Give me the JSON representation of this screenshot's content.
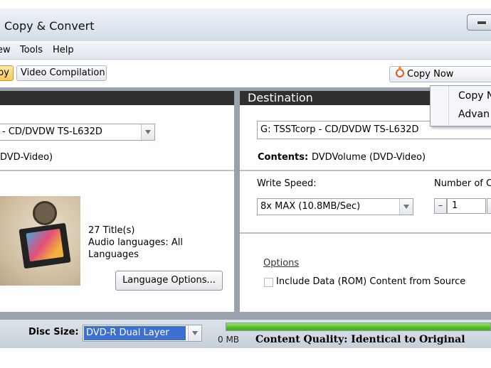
{
  "window": {
    "title": "Copy & Convert"
  },
  "menubar": {
    "items": [
      "ew",
      "Tools",
      "Help"
    ]
  },
  "toolbar": {
    "tabs": [
      {
        "label": "py",
        "active": true
      },
      {
        "label": "Video Compilation",
        "active": false
      }
    ],
    "copy_now_label": "Copy Now"
  },
  "copy_menu": {
    "items": [
      "Copy N",
      "Advan"
    ]
  },
  "source": {
    "drive_value": " - CD/DVDW TS-L632D",
    "contents_value": "DVD-Video)",
    "title_count": "27 Title(s)",
    "audio_languages_line1": "Audio languages: All",
    "audio_languages_line2": "Languages",
    "language_options_label": "Language Options..."
  },
  "destination": {
    "header": "Destination",
    "drive_value": "G: TSSTcorp - CD/DVDW TS-L632D",
    "contents_label": "Contents:",
    "contents_value": "DVDVolume (DVD-Video)",
    "write_speed_label": "Write Speed:",
    "write_speed_value": "8x MAX (10.8MB/Sec)",
    "copies_label": "Number of C",
    "copies_value": "1",
    "copies_minus": "–",
    "options_label": "Options",
    "include_data_label": "Include Data (ROM) Content from Source",
    "include_data_checked": false
  },
  "footer": {
    "disc_size_label": "Disc Size:",
    "disc_size_value": "DVD-R Dual Layer",
    "size_used": "0 MB",
    "quality_text": "Content Quality: Identical to Original",
    "progress_fraction": 1.0
  },
  "icons": {
    "copy_now": "flame-disc-icon",
    "thumbnail": "film-reel-image"
  },
  "colors": {
    "accent_active_tab": "#f7c95a",
    "header_dark": "#2f2f2f",
    "progress_green": "#54bd28",
    "selection_blue": "#3d6fd1"
  }
}
